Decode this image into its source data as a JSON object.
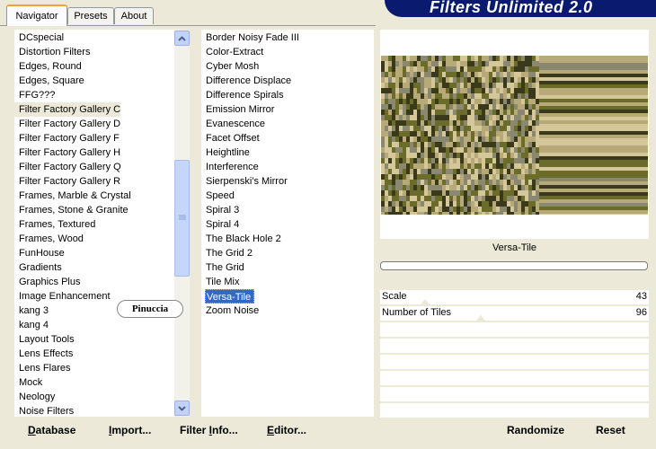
{
  "header": {
    "title": "Filters Unlimited 2.0"
  },
  "tabs": [
    {
      "label": "Navigator",
      "active": true
    },
    {
      "label": "Presets",
      "active": false
    },
    {
      "label": "About",
      "active": false
    }
  ],
  "categories": {
    "items": [
      "DCspecial",
      "Distortion Filters",
      "Edges, Round",
      "Edges, Square",
      "FFG???",
      "Filter Factory Gallery C",
      "Filter Factory Gallery D",
      "Filter Factory Gallery F",
      "Filter Factory Gallery H",
      "Filter Factory Gallery Q",
      "Filter Factory Gallery R",
      "Frames, Marble & Crystal",
      "Frames, Stone & Granite",
      "Frames, Textured",
      "Frames, Wood",
      "FunHouse",
      "Gradients",
      "Graphics Plus",
      "Image Enhancement",
      "kang 3",
      "kang 4",
      "Layout Tools",
      "Lens Effects",
      "Lens Flares",
      "Mock",
      "Neology",
      "Noise Filters"
    ],
    "highlighted_index": 5
  },
  "filters": {
    "items": [
      "Border Noisy Fade III",
      "Color-Extract",
      "Cyber Mosh",
      "Difference Displace",
      "Difference Spirals",
      "Emission Mirror",
      "Evanescence",
      "Facet Offset",
      "Heightline",
      "Interference",
      "Sierpenski's Mirror",
      "Speed",
      "Spiral 3",
      "Spiral 4",
      "The Black Hole 2",
      "The Grid 2",
      "The Grid",
      "Tile Mix",
      "Versa-Tile",
      "Zoom Noise"
    ],
    "selected_index": 18
  },
  "preview": {
    "filter_name": "Versa-Tile",
    "colors": {
      "olive": "#6b6b2a",
      "dark": "#3a3a1a",
      "tan": "#b8aa78",
      "grey": "#8a8870",
      "light": "#d4c89a"
    }
  },
  "params": [
    {
      "label": "Scale",
      "value": "43"
    },
    {
      "label": "Number of Tiles",
      "value": "96"
    }
  ],
  "watermark": {
    "text": "Pinuccia"
  },
  "buttons": {
    "database": {
      "pre": "",
      "u": "D",
      "post": "atabase"
    },
    "import": {
      "pre": "",
      "u": "I",
      "post": "mport..."
    },
    "filter_info": {
      "pre": "Filter ",
      "u": "I",
      "post": "nfo..."
    },
    "editor": {
      "pre": "",
      "u": "E",
      "post": "ditor..."
    },
    "randomize": "Randomize",
    "reset": "Reset"
  }
}
